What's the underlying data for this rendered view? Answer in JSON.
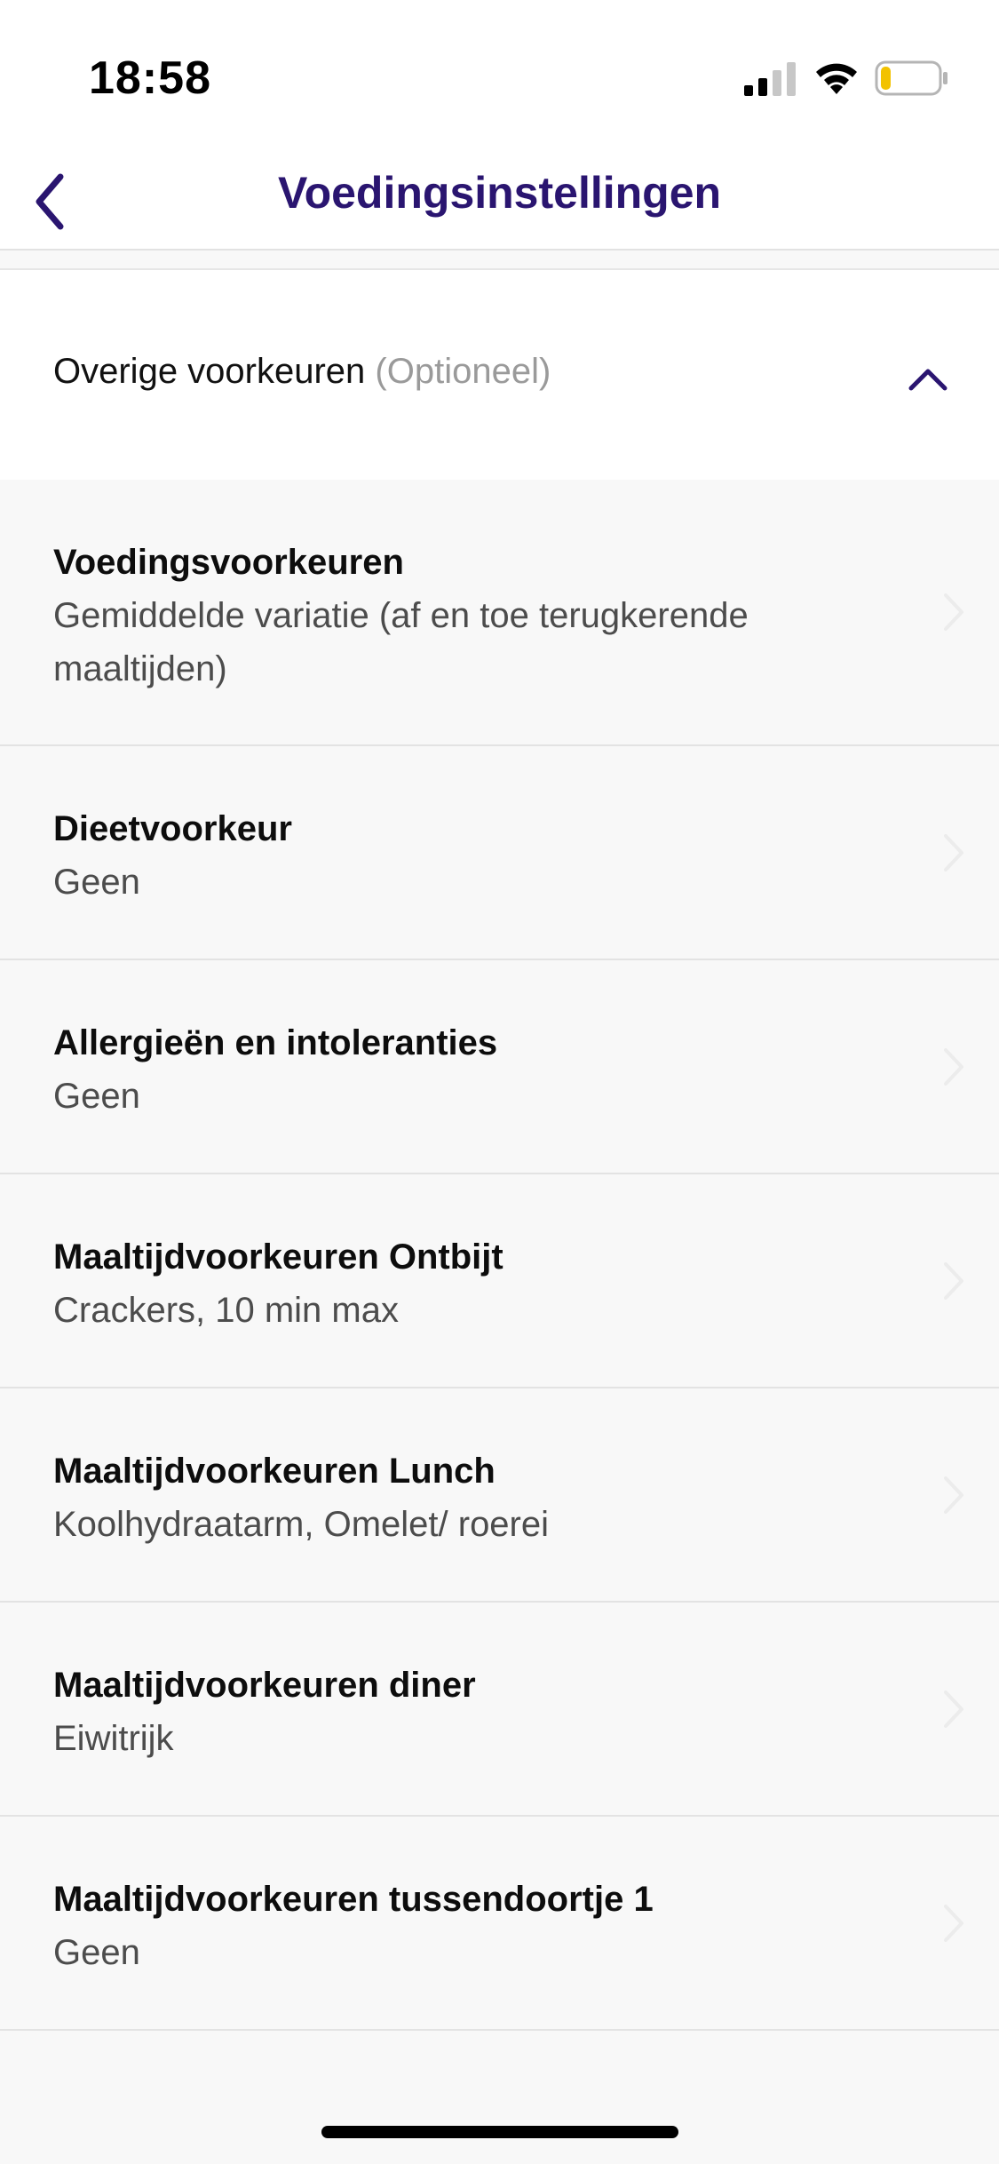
{
  "status_bar": {
    "time": "18:58",
    "signal_icon": "cellular-signal-icon",
    "wifi_icon": "wifi-icon",
    "battery_icon": "battery-low-icon",
    "battery_level": 0.15,
    "battery_color": "#f2c200"
  },
  "nav": {
    "title": "Voedingsinstellingen",
    "back_icon": "chevron-left-icon",
    "accent_color": "#2a1570"
  },
  "section": {
    "title": "Overige voorkeuren",
    "optional": "(Optioneel)",
    "toggle_icon": "chevron-up-icon"
  },
  "preferences": [
    {
      "title": "Voedingsvoorkeuren",
      "value": "Gemiddelde variatie (af en toe terugkerende maaltijden)"
    },
    {
      "title": "Dieetvoorkeur",
      "value": "Geen"
    },
    {
      "title": "Allergieën en intoleranties",
      "value": "Geen"
    },
    {
      "title": "Maaltijdvoorkeuren Ontbijt",
      "value": "Crackers, 10 min max"
    },
    {
      "title": "Maaltijdvoorkeuren Lunch",
      "value": "Koolhydraatarm, Omelet/ roerei"
    },
    {
      "title": "Maaltijdvoorkeuren diner",
      "value": "Eiwitrijk"
    },
    {
      "title": "Maaltijdvoorkeuren tussendoortje 1",
      "value": "Geen"
    }
  ]
}
